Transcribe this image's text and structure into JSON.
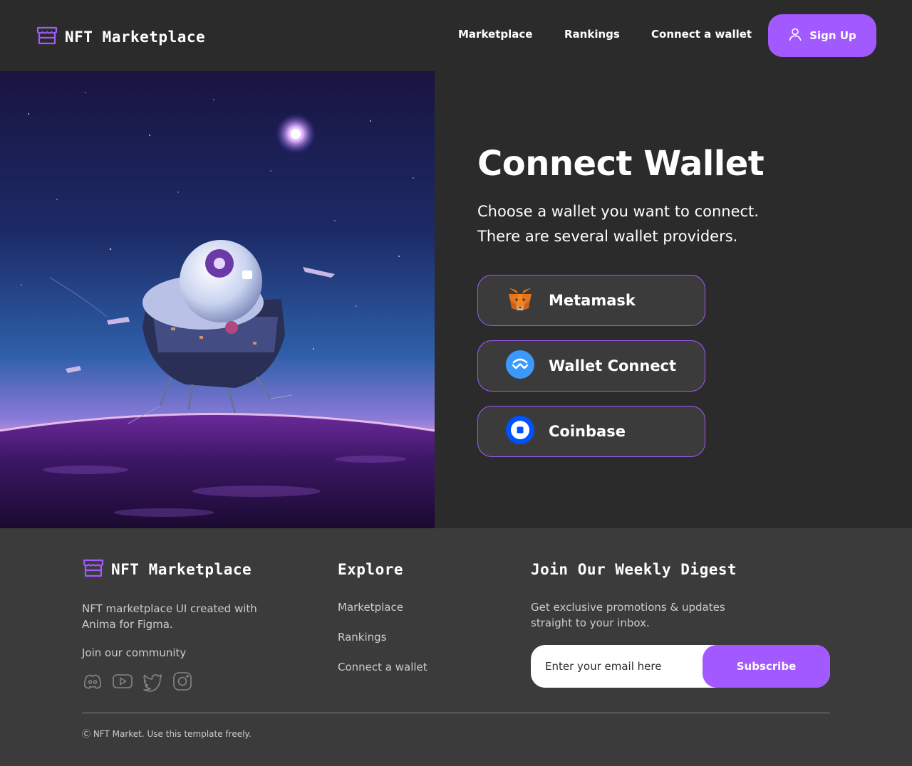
{
  "colors": {
    "background": "#2b2b2b",
    "surface": "#3b3b3b",
    "accent": "#a259ff",
    "text": "#ffffff",
    "muted_text": "#cccccc",
    "divider": "#858584"
  },
  "header": {
    "logo_icon": "storefront-icon",
    "brand": "NFT Marketplace",
    "nav": [
      {
        "label": "Marketplace"
      },
      {
        "label": "Rankings"
      },
      {
        "label": "Connect a wallet"
      }
    ],
    "signup": {
      "icon": "user-icon",
      "label": "Sign Up"
    }
  },
  "hero": {
    "image": "astronaut-helmet-spaceship-over-purple-planet"
  },
  "main": {
    "title": "Connect Wallet",
    "subtitle": "Choose a wallet you want to connect. There are several wallet providers.",
    "wallets": [
      {
        "icon": "metamask-fox-icon",
        "label": "Metamask"
      },
      {
        "icon": "walletconnect-icon",
        "label": "Wallet Connect"
      },
      {
        "icon": "coinbase-icon",
        "label": "Coinbase"
      }
    ]
  },
  "footer": {
    "brand": "NFT Marketplace",
    "description": "NFT marketplace UI created with Anima for Figma.",
    "community_label": "Join our community",
    "socials": [
      {
        "icon": "discord-icon"
      },
      {
        "icon": "youtube-icon"
      },
      {
        "icon": "twitter-icon"
      },
      {
        "icon": "instagram-icon"
      }
    ],
    "explore": {
      "heading": "Explore",
      "links": [
        {
          "label": "Marketplace"
        },
        {
          "label": "Rankings"
        },
        {
          "label": "Connect a wallet"
        }
      ]
    },
    "digest": {
      "heading": "Join Our Weekly Digest",
      "text": "Get exclusive promotions & updates straight to your inbox.",
      "email_placeholder": "Enter your email here",
      "subscribe_label": "Subscribe"
    },
    "copyright": "Ⓒ NFT Market. Use this template freely."
  }
}
